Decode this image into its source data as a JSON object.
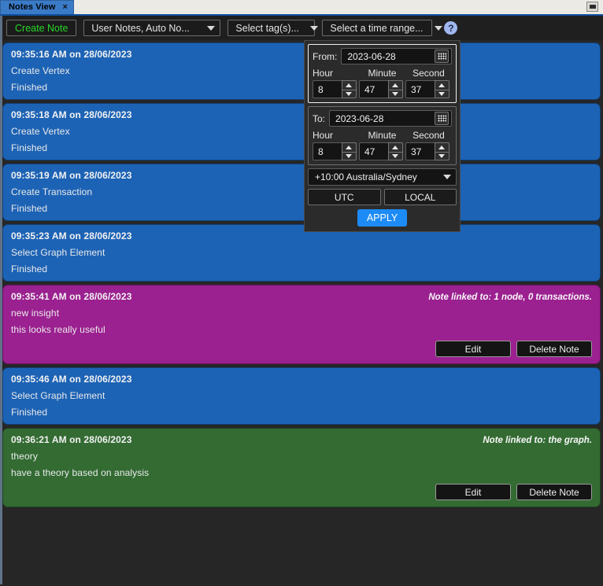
{
  "window": {
    "tab_label": "Notes View",
    "tab_close": "×",
    "restore_icon": "restore-icon"
  },
  "toolbar": {
    "create_note_label": "Create Note",
    "notes_filter_value": "User Notes, Auto No...",
    "tags_filter_value": "Select tag(s)...",
    "time_range_value": "Select a time range...",
    "help_label": "?",
    "accent_green": "#27d527",
    "help_bg": "#9fb6ef"
  },
  "time_popup": {
    "from": {
      "label": "From:",
      "date": "2023-06-28",
      "hour_label": "Hour",
      "minute_label": "Minute",
      "second_label": "Second",
      "hour": "8",
      "minute": "47",
      "second": "37"
    },
    "to": {
      "label": "To:",
      "date": "2023-06-28",
      "hour_label": "Hour",
      "minute_label": "Minute",
      "second_label": "Second",
      "hour": "8",
      "minute": "47",
      "second": "37"
    },
    "timezone": "+10:00 Australia/Sydney",
    "utc_label": "UTC",
    "local_label": "LOCAL",
    "apply_label": "APPLY",
    "apply_color": "#1d8bf5"
  },
  "notes": [
    {
      "kind": "log",
      "color": "#1d63b5",
      "time": "09:35:16 AM on 28/06/2023",
      "line1": "Create Vertex",
      "line2": "Finished",
      "linked": "",
      "has_actions": false
    },
    {
      "kind": "log",
      "color": "#1d63b5",
      "time": "09:35:18 AM on 28/06/2023",
      "line1": "Create Vertex",
      "line2": "Finished",
      "linked": "",
      "has_actions": false
    },
    {
      "kind": "log",
      "color": "#1d63b5",
      "time": "09:35:19 AM on 28/06/2023",
      "line1": "Create Transaction",
      "line2": "Finished",
      "linked": "",
      "has_actions": false
    },
    {
      "kind": "log",
      "color": "#1d63b5",
      "time": "09:35:23 AM on 28/06/2023",
      "line1": "Select Graph Element",
      "line2": "Finished",
      "linked": "",
      "has_actions": false
    },
    {
      "kind": "user-a",
      "color": "#9b2090",
      "time": "09:35:41 AM on 28/06/2023",
      "line1": "new insight",
      "line2": "this looks really useful",
      "linked": "Note linked to: 1 node, 0 transactions.",
      "has_actions": true,
      "edit_label": "Edit",
      "delete_label": "Delete Note"
    },
    {
      "kind": "log",
      "color": "#1d63b5",
      "time": "09:35:46 AM on 28/06/2023",
      "line1": "Select Graph Element",
      "line2": "Finished",
      "linked": "",
      "has_actions": false
    },
    {
      "kind": "user-b",
      "color": "#336b33",
      "time": "09:36:21 AM on 28/06/2023",
      "line1": "theory",
      "line2": "have a theory based on analysis",
      "linked": "Note linked to: the graph.",
      "has_actions": true,
      "edit_label": "Edit",
      "delete_label": "Delete Note"
    }
  ]
}
